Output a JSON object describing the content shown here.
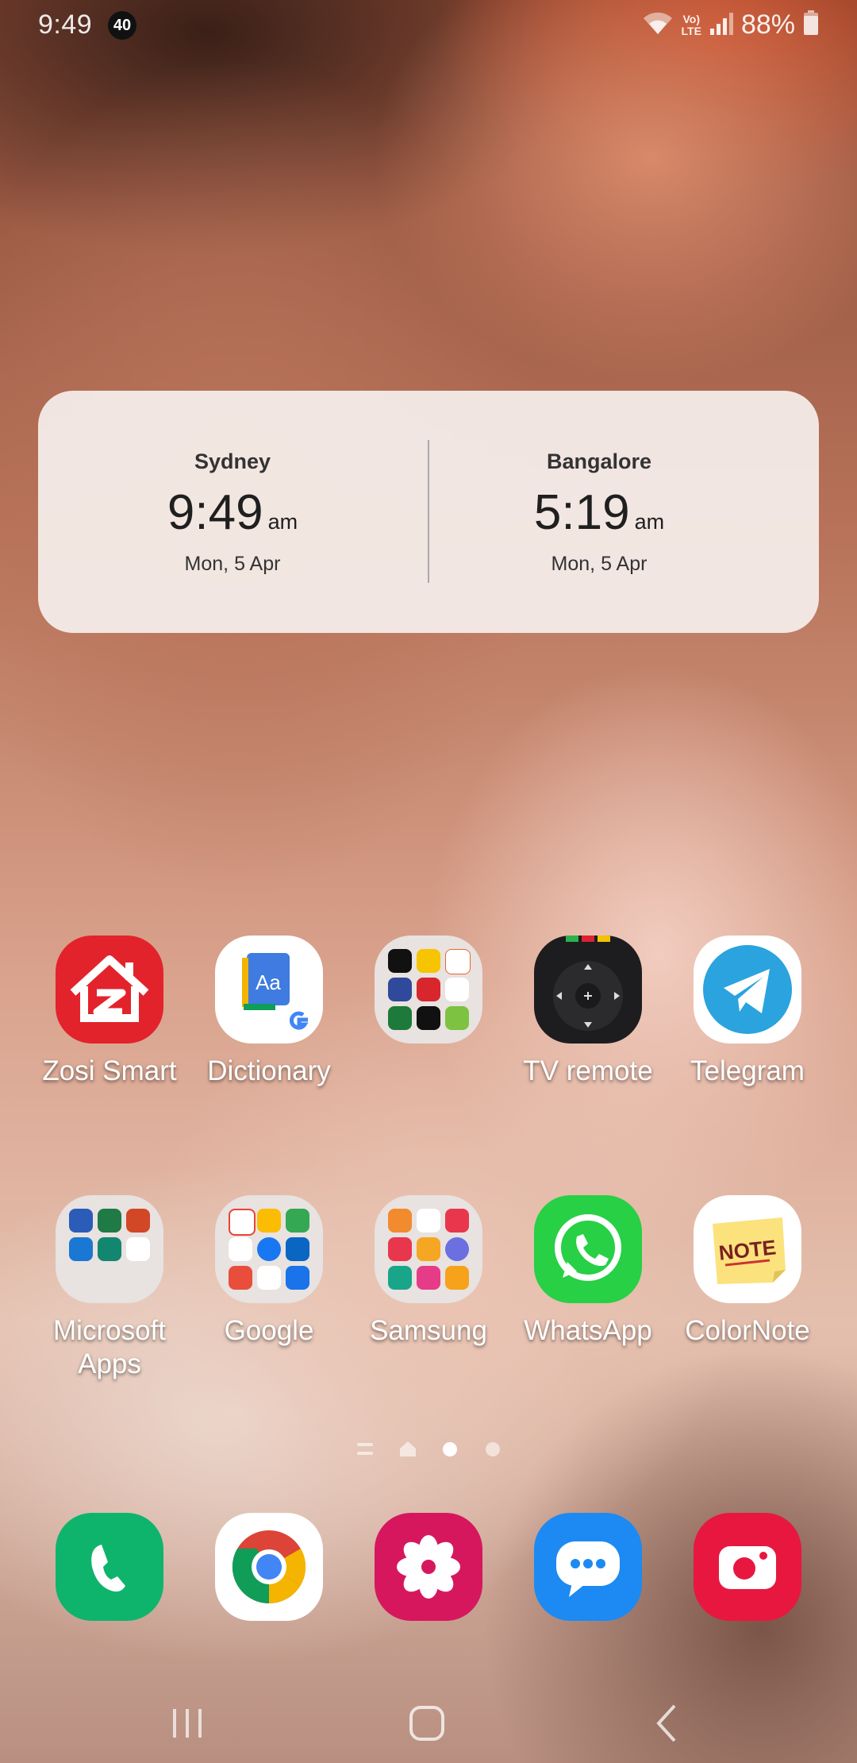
{
  "status_bar": {
    "time": "9:49",
    "notification_badge": "40",
    "lte_label_1": "Vo)",
    "lte_label_2": "LTE",
    "battery_percent": "88%"
  },
  "clock_widget": {
    "clocks": [
      {
        "city": "Sydney",
        "time": "9:49",
        "ampm": "am",
        "date": "Mon, 5 Apr"
      },
      {
        "city": "Bangalore",
        "time": "5:19",
        "ampm": "am",
        "date": "Mon, 5 Apr"
      }
    ]
  },
  "home_row_1": [
    {
      "label": "Zosi Smart",
      "icon": "zosi-house-icon"
    },
    {
      "label": "Dictionary",
      "icon": "dictionary-icon"
    },
    {
      "label": "",
      "icon": "folder-icon"
    },
    {
      "label": "TV remote",
      "icon": "tv-remote-icon"
    },
    {
      "label": "Telegram",
      "icon": "telegram-icon"
    }
  ],
  "home_row_2": [
    {
      "label": "Microsoft Apps",
      "label_line1": "Microsoft",
      "label_line2": "Apps",
      "icon": "folder-icon"
    },
    {
      "label": "Google",
      "icon": "folder-icon"
    },
    {
      "label": "Samsung",
      "icon": "folder-icon"
    },
    {
      "label": "WhatsApp",
      "icon": "whatsapp-icon"
    },
    {
      "label": "ColorNote",
      "icon": "colornote-icon"
    }
  ],
  "colornote_text": "NOTE",
  "dictionary_text": "Aa",
  "dock": [
    {
      "icon": "phone-icon"
    },
    {
      "icon": "chrome-icon"
    },
    {
      "icon": "gallery-icon"
    },
    {
      "icon": "messages-icon"
    },
    {
      "icon": "camera-icon"
    }
  ],
  "page_indicator": {
    "pages": 4,
    "active_index": 2
  },
  "colors": {
    "zosi": "#e3232c",
    "telegram": "#2aa3de",
    "whatsapp": "#27d045",
    "phone": "#0fb46c",
    "gallery": "#d6175e",
    "messages": "#1c8af2",
    "camera": "#e8173f"
  }
}
